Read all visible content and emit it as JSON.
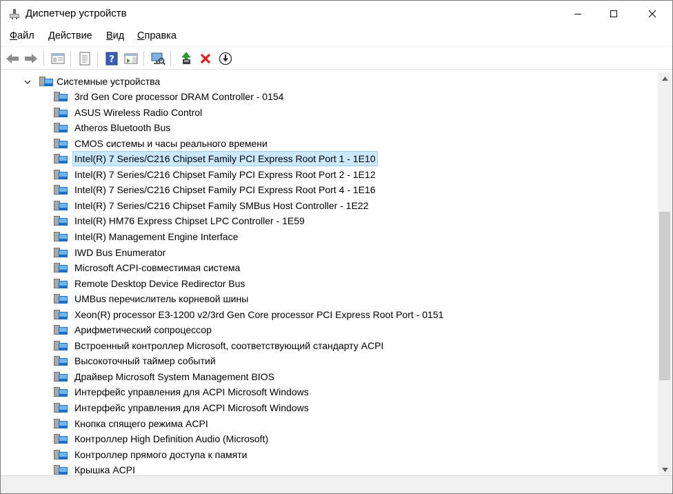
{
  "window": {
    "title": "Диспетчер устройств"
  },
  "menu": [
    {
      "label": "Файл"
    },
    {
      "label": "Действие"
    },
    {
      "label": "Вид"
    },
    {
      "label": "Справка"
    }
  ],
  "toolbar": {
    "icons": [
      "back-arrow-icon",
      "forward-arrow-icon",
      "show-hide-console-tree-icon",
      "properties-icon",
      "help-icon",
      "action-pane-icon",
      "scan-hardware-icon",
      "update-driver-icon",
      "uninstall-device-icon",
      "disable-device-icon"
    ]
  },
  "tree": {
    "root_label": "Системные устройства",
    "selected_index": 4,
    "items": [
      "3rd Gen Core processor DRAM Controller - 0154",
      "ASUS Wireless Radio Control",
      "Atheros Bluetooth Bus",
      "CMOS системы и часы реального времени",
      "Intel(R) 7 Series/C216 Chipset Family PCI Express Root Port 1 - 1E10",
      "Intel(R) 7 Series/C216 Chipset Family PCI Express Root Port 2 - 1E12",
      "Intel(R) 7 Series/C216 Chipset Family PCI Express Root Port 4 - 1E16",
      "Intel(R) 7 Series/C216 Chipset Family SMBus Host Controller - 1E22",
      "Intel(R) HM76 Express Chipset LPC Controller - 1E59",
      "Intel(R) Management Engine Interface",
      "IWD Bus Enumerator",
      "Microsoft ACPI-совместимая система",
      "Remote Desktop Device Redirector Bus",
      "UMBus перечислитель корневой шины",
      "Xeon(R) processor E3-1200 v2/3rd Gen Core processor PCI Express Root Port - 0151",
      "Арифметический сопроцессор",
      "Встроенный контроллер Microsoft, соответствующий стандарту ACPI",
      "Высокоточный таймер событий",
      "Драйвер Microsoft System Management BIOS",
      "Интерфейс управления для ACPI Microsoft Windows",
      "Интерфейс управления для ACPI Microsoft Windows",
      "Кнопка спящего режима ACPI",
      "Контроллер High Definition Audio (Microsoft)",
      "Контроллер прямого доступа к памяти",
      "Крышка ACPI"
    ]
  },
  "colors": {
    "selection_bg": "#cce8ff",
    "selection_border": "#99d1ff",
    "device_icon_blue": "#1e88d8"
  }
}
